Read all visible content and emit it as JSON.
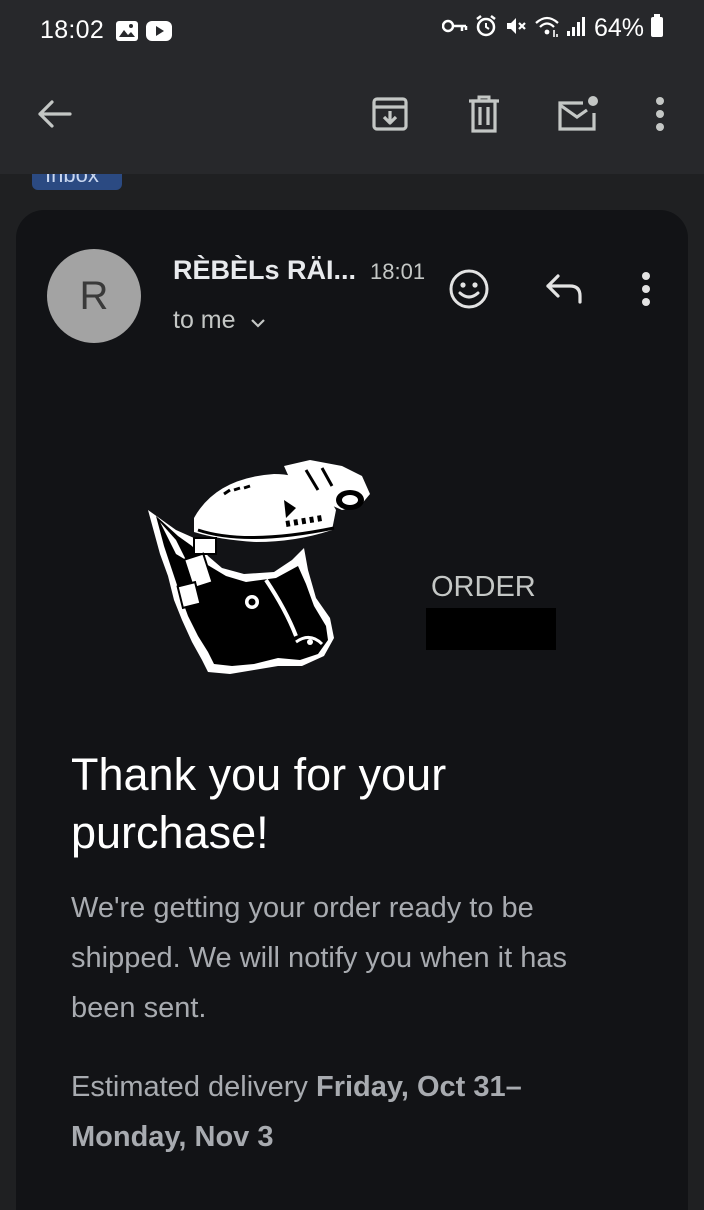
{
  "status_bar": {
    "time": "18:02",
    "left_icons": [
      "image-icon",
      "youtube-icon"
    ],
    "right_icons": [
      "vpn-key-icon",
      "alarm-icon",
      "mute-icon",
      "wifi-icon",
      "signal-icon"
    ],
    "battery": "64%"
  },
  "toolbar": {
    "icons": [
      "back-arrow-icon",
      "archive-icon",
      "delete-icon",
      "mark-unread-icon",
      "more-vert-icon"
    ]
  },
  "label_chip": "Inbox",
  "message": {
    "avatar_letter": "R",
    "sender": "RÈBÈLs RÄI...",
    "time": "18:01",
    "recipient": "to me",
    "order_label": "ORDER",
    "headline_line1": "Thank you for your",
    "headline_line2": "purchase!",
    "body": "We're getting your order ready to be shipped. We will notify you when it has been sent.",
    "delivery_prefix": "Estimated delivery ",
    "delivery_dates": "Friday, Oct 31–Monday, Nov 3"
  }
}
